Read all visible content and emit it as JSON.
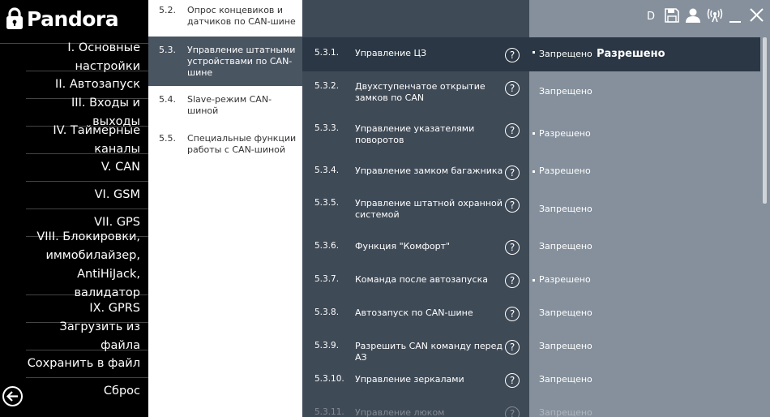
{
  "brand": {
    "name": "Pandora"
  },
  "sidebar": {
    "items": [
      {
        "label": "I. Основные настройки"
      },
      {
        "label": "II. Автозапуск"
      },
      {
        "label": "III. Входы и выходы"
      },
      {
        "label": "IV. Таймерные каналы"
      },
      {
        "label": "V. CAN"
      },
      {
        "label": "VI. GSM"
      },
      {
        "label": "VII. GPS"
      },
      {
        "label": "VIII. Блокировки,\nиммобилайзер,\nAntiHiJack, валидатор"
      },
      {
        "label": "IX. GPRS"
      },
      {
        "label": "Загрузить из файла"
      },
      {
        "label": "Сохранить в файл"
      },
      {
        "label": "Сброс"
      }
    ]
  },
  "submenu": {
    "items": [
      {
        "num": "5.2.",
        "label": "Опрос концевиков и датчиков по CAN-шине"
      },
      {
        "num": "5.3.",
        "label": "Управление штатными устройствами по CAN-шине"
      },
      {
        "num": "5.4.",
        "label": "Slave-режим CAN-шиной"
      },
      {
        "num": "5.5.",
        "label": "Специальные функции работы с CAN-шиной"
      }
    ]
  },
  "titlebar": {
    "user_letter": "D"
  },
  "settings": {
    "rows": [
      {
        "num": "5.3.1.",
        "label": "Управление ЦЗ",
        "value": "Запрещено",
        "alt_value": "Разрешено"
      },
      {
        "num": "5.3.2.",
        "label": "Двухступенчатое открытие замков по CAN",
        "value": "Запрещено"
      },
      {
        "num": "5.3.3.",
        "label": "Управление указателями поворотов",
        "value": "Разрешено"
      },
      {
        "num": "5.3.4.",
        "label": "Управление замком багажника",
        "value": "Разрешено"
      },
      {
        "num": "5.3.5.",
        "label": "Управление штатной охранной системой",
        "value": "Запрещено"
      },
      {
        "num": "5.3.6.",
        "label": "Функция \"Комфорт\"",
        "value": "Запрещено"
      },
      {
        "num": "5.3.7.",
        "label": "Команда после автозапуска",
        "value": "Разрешено"
      },
      {
        "num": "5.3.8.",
        "label": "Автозапуск по CAN-шине",
        "value": "Запрещено"
      },
      {
        "num": "5.3.9.",
        "label": "Разрешить CAN команду перед АЗ",
        "value": "Запрещено"
      },
      {
        "num": "5.3.10.",
        "label": "Управление зеркалами",
        "value": "Запрещено"
      },
      {
        "num": "5.3.11.",
        "label": "Управление люком",
        "value": "Запрещено"
      }
    ],
    "help_symbol": "?"
  },
  "colors": {
    "sidebar_bg": "#000000",
    "submenu_bg": "#ffffff",
    "submenu_active": "#4a5562",
    "middle_bg": "#3f4a57",
    "right_bg": "#85909c",
    "selected_row_bg": "#2b3744"
  }
}
